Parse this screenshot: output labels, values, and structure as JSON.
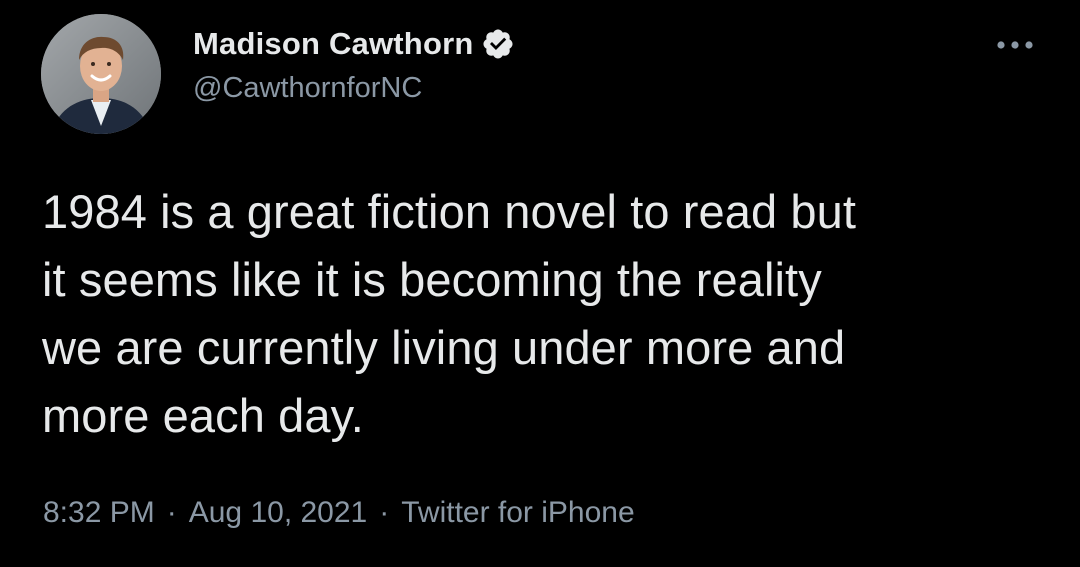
{
  "tweet": {
    "author": {
      "display_name": "Madison Cawthorn",
      "handle": "@CawthornforNC",
      "verified": true,
      "avatar_icon": "profile-photo"
    },
    "more_icon": "ellipsis-icon",
    "text": "1984 is a great fiction novel to read but\nit seems like it is becoming the reality\nwe are currently living under more and\nmore each day.",
    "time": "8:32 PM",
    "date": "Aug 10, 2021",
    "separator": "·",
    "source": "Twitter for iPhone"
  },
  "colors": {
    "background": "#000000",
    "primary_text": "#e7e9ea",
    "secondary_text": "#8b98a5",
    "verified_badge": "#e7e9ea"
  }
}
